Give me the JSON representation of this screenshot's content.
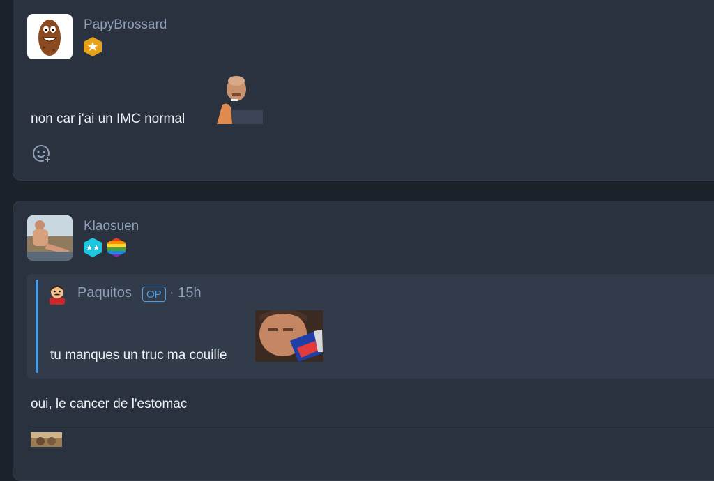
{
  "post1": {
    "username": "PapyBrossard",
    "message": "non car j'ai un IMC normal",
    "badges": [
      "gold-star-badge"
    ],
    "reaction_icon": "add-reaction-icon"
  },
  "post2": {
    "username": "Klaosuen",
    "badges": [
      "two-star-badge",
      "rainbow-badge"
    ],
    "quote": {
      "username": "Paquitos",
      "op_label": "OP",
      "time": "· 15h",
      "message": "tu manques un truc ma couille"
    },
    "message": "oui, le cancer de l'estomac"
  },
  "colors": {
    "background": "#1c222a",
    "card": "#2a3240",
    "quote_bg": "#323b4a",
    "accent": "#4a9fe8",
    "username": "#8fa0b8"
  }
}
